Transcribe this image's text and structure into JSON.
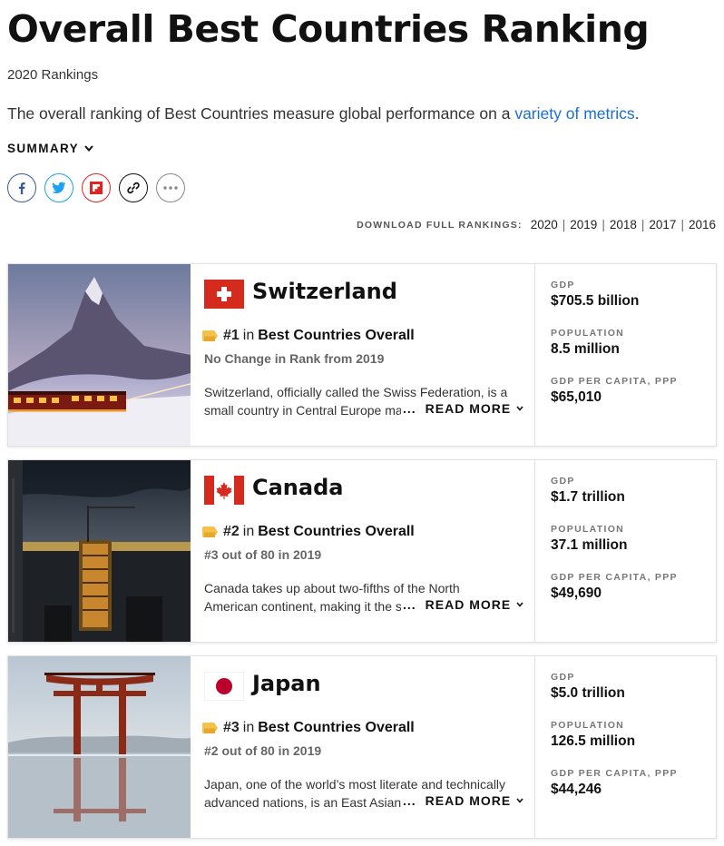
{
  "page": {
    "title": "Overall Best Countries Ranking",
    "subtitle": "2020 Rankings",
    "intro_text": "The overall ranking of Best Countries measure global performance on a ",
    "intro_link": "variety of metrics",
    "intro_end": ".",
    "summary_label": "SUMMARY"
  },
  "share": {
    "icons": [
      "facebook-icon",
      "twitter-icon",
      "flipboard-icon",
      "link-icon",
      "more-icon"
    ]
  },
  "downloads": {
    "label": "DOWNLOAD FULL RANKINGS:",
    "years": [
      "2020",
      "2019",
      "2018",
      "2017",
      "2016"
    ],
    "separator": "|"
  },
  "labels": {
    "in": "in",
    "read_more": "READ MORE",
    "ellipsis": "...",
    "gdp": "GDP",
    "population": "POPULATION",
    "gdp_per_capita": "GDP PER CAPITA, PPP"
  },
  "countries": [
    {
      "name": "Switzerland",
      "rank": "#1",
      "category": "Best Countries Overall",
      "change": "No Change in Rank from 2019",
      "description": "Switzerland, officially called the Swiss Federation, is a small country in Central Europe ma",
      "gdp": "$705.5 billion",
      "population": "8.5 million",
      "gdp_per_capita": "$65,010"
    },
    {
      "name": "Canada",
      "rank": "#2",
      "category": "Best Countries Overall",
      "change": "#3 out of 80 in 2019",
      "description": "Canada takes up about two-fifths of the North American continent, making it the second-lar",
      "gdp": "$1.7 trillion",
      "population": "37.1 million",
      "gdp_per_capita": "$49,690"
    },
    {
      "name": "Japan",
      "rank": "#3",
      "category": "Best Countries Overall",
      "change": "#2 out of 80 in 2019",
      "description": "Japan, one of the world’s most literate and technically advanced nations, is an East Asian",
      "gdp": "$5.0 trillion",
      "population": "126.5 million",
      "gdp_per_capita": "$44,246"
    }
  ],
  "colors": {
    "link": "#1a6ed8",
    "facebook": "#3b5998",
    "twitter": "#1da1f2",
    "flipboard": "#e02424",
    "swiss_red": "#d52b1e",
    "canada_red": "#d52b1e",
    "japan_red": "#bc002d",
    "tag_yellow": "#f5c14b"
  }
}
